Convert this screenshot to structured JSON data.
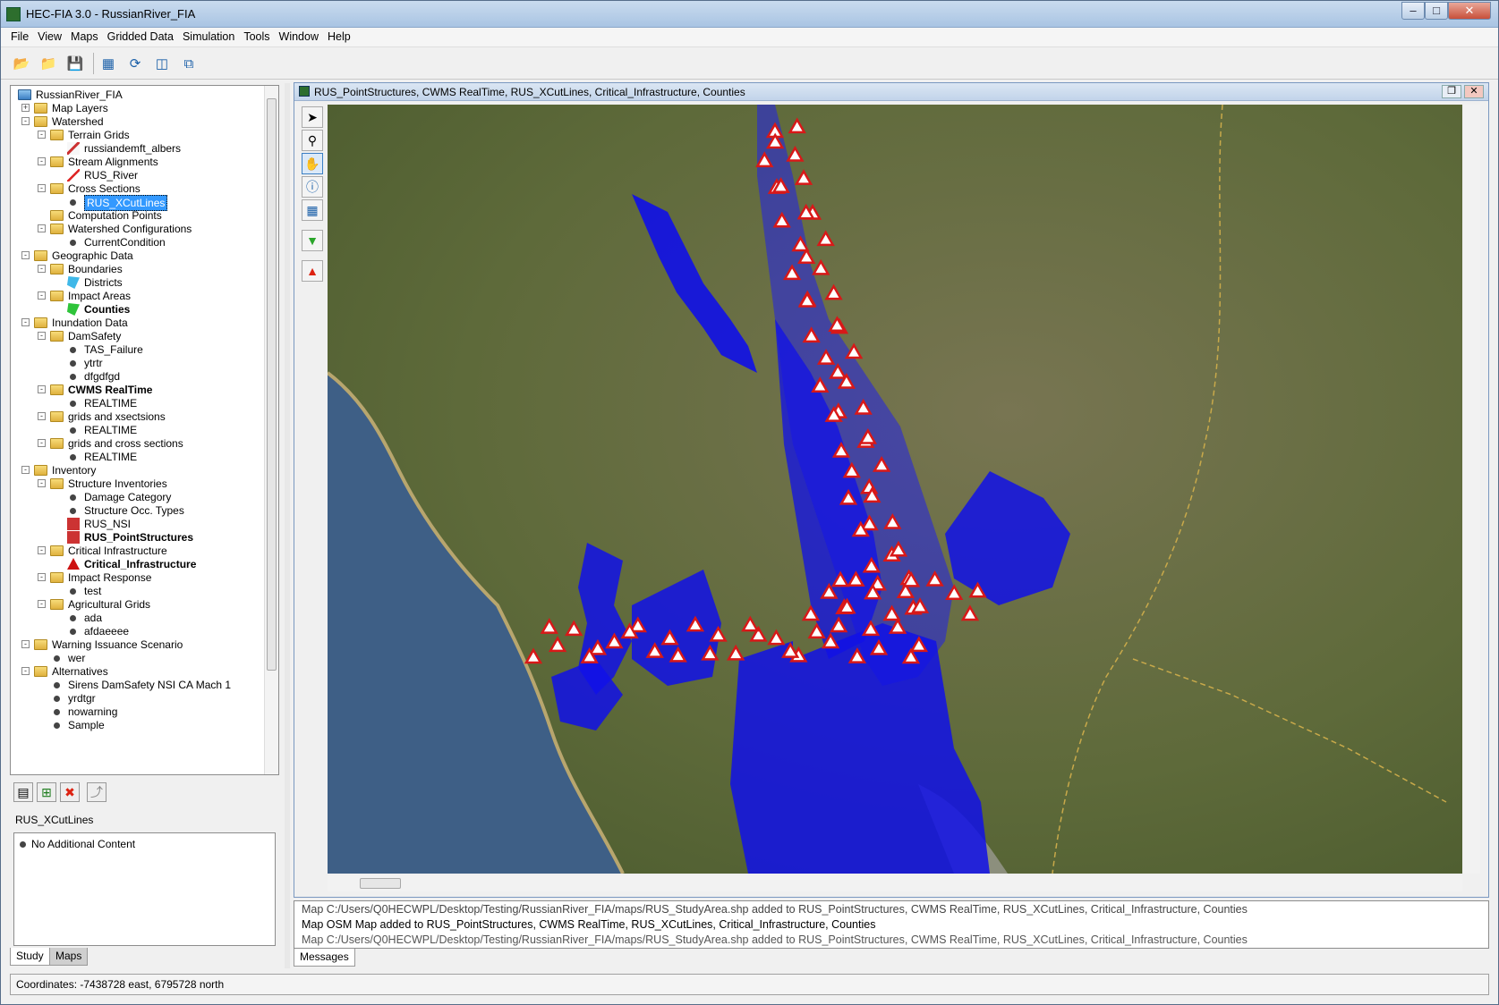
{
  "window": {
    "title": "HEC-FIA 3.0 - RussianRiver_FIA"
  },
  "menu": [
    "File",
    "View",
    "Maps",
    "Gridded Data",
    "Simulation",
    "Tools",
    "Window",
    "Help"
  ],
  "tree": {
    "root": "RussianRiver_FIA",
    "items": [
      {
        "label": "Map Layers",
        "level": 1,
        "type": "folder",
        "exp": "+"
      },
      {
        "label": "Watershed",
        "level": 1,
        "type": "folder",
        "exp": "-"
      },
      {
        "label": "Terrain Grids",
        "level": 2,
        "type": "folder",
        "exp": "-"
      },
      {
        "label": "russiandemft_albers",
        "level": 3,
        "type": "terrain"
      },
      {
        "label": "Stream Alignments",
        "level": 2,
        "type": "folder",
        "exp": "-"
      },
      {
        "label": "RUS_River",
        "level": 3,
        "type": "stream"
      },
      {
        "label": "Cross Sections",
        "level": 2,
        "type": "folder",
        "exp": "-"
      },
      {
        "label": "RUS_XCutLines",
        "level": 3,
        "type": "dot",
        "selected": true
      },
      {
        "label": "Computation Points",
        "level": 2,
        "type": "folder"
      },
      {
        "label": "Watershed Configurations",
        "level": 2,
        "type": "folder",
        "exp": "-"
      },
      {
        "label": "CurrentCondition",
        "level": 3,
        "type": "dot"
      },
      {
        "label": "Geographic Data",
        "level": 1,
        "type": "folder",
        "exp": "-"
      },
      {
        "label": "Boundaries",
        "level": 2,
        "type": "folder",
        "exp": "-"
      },
      {
        "label": "Districts",
        "level": 3,
        "type": "district"
      },
      {
        "label": "Impact Areas",
        "level": 2,
        "type": "folder",
        "exp": "-"
      },
      {
        "label": "Counties",
        "level": 3,
        "type": "county",
        "bold": true
      },
      {
        "label": "Inundation Data",
        "level": 1,
        "type": "folder",
        "exp": "-"
      },
      {
        "label": "DamSafety",
        "level": 2,
        "type": "folder",
        "exp": "-"
      },
      {
        "label": "TAS_Failure",
        "level": 3,
        "type": "dot"
      },
      {
        "label": "ytrtr",
        "level": 3,
        "type": "dot"
      },
      {
        "label": "dfgdfgd",
        "level": 3,
        "type": "dot"
      },
      {
        "label": "CWMS RealTime",
        "level": 2,
        "type": "folder",
        "exp": "-",
        "bold": true
      },
      {
        "label": "REALTIME",
        "level": 3,
        "type": "dot"
      },
      {
        "label": "grids and xsectsions",
        "level": 2,
        "type": "folder",
        "exp": "-"
      },
      {
        "label": "REALTIME",
        "level": 3,
        "type": "dot"
      },
      {
        "label": "grids and cross sections",
        "level": 2,
        "type": "folder",
        "exp": "-"
      },
      {
        "label": "REALTIME",
        "level": 3,
        "type": "dot"
      },
      {
        "label": "Inventory",
        "level": 1,
        "type": "folder",
        "exp": "-"
      },
      {
        "label": "Structure Inventories",
        "level": 2,
        "type": "folder",
        "exp": "-"
      },
      {
        "label": "Damage Category",
        "level": 3,
        "type": "dot"
      },
      {
        "label": "Structure Occ. Types",
        "level": 3,
        "type": "dot"
      },
      {
        "label": "RUS_NSI",
        "level": 3,
        "type": "structure"
      },
      {
        "label": "RUS_PointStructures",
        "level": 3,
        "type": "structure",
        "bold": true
      },
      {
        "label": "Critical Infrastructure",
        "level": 2,
        "type": "folder",
        "exp": "-"
      },
      {
        "label": "Critical_Infrastructure",
        "level": 3,
        "type": "warning",
        "bold": true
      },
      {
        "label": "Impact Response",
        "level": 2,
        "type": "folder",
        "exp": "-"
      },
      {
        "label": "test",
        "level": 3,
        "type": "dot"
      },
      {
        "label": "Agricultural Grids",
        "level": 2,
        "type": "folder",
        "exp": "-"
      },
      {
        "label": "ada",
        "level": 3,
        "type": "dot"
      },
      {
        "label": "afdaeeee",
        "level": 3,
        "type": "dot"
      },
      {
        "label": "Warning Issuance Scenario",
        "level": 1,
        "type": "folder",
        "exp": "-"
      },
      {
        "label": "wer",
        "level": 2,
        "type": "dot"
      },
      {
        "label": "Alternatives",
        "level": 1,
        "type": "folder",
        "exp": "-"
      },
      {
        "label": "Sirens DamSafety NSI CA Mach 1",
        "level": 2,
        "type": "dot"
      },
      {
        "label": "yrdtgr",
        "level": 2,
        "type": "dot"
      },
      {
        "label": "nowarning",
        "level": 2,
        "type": "dot"
      },
      {
        "label": "Sample",
        "level": 2,
        "type": "dot"
      }
    ]
  },
  "selected_item": "RUS_XCutLines",
  "content_panel": {
    "line": "No Additional Content"
  },
  "left_tabs": {
    "study": "Study",
    "maps": "Maps"
  },
  "map_window": {
    "title": "RUS_PointStructures, CWMS RealTime, RUS_XCutLines, Critical_Infrastructure, Counties"
  },
  "messages": [
    "Map C:/Users/Q0HECWPL/Desktop/Testing/RussianRiver_FIA/maps/RUS_StudyArea.shp added to RUS_PointStructures, CWMS RealTime, RUS_XCutLines, Critical_Infrastructure, Counties",
    "Map OSM Map added to RUS_PointStructures, CWMS RealTime, RUS_XCutLines, Critical_Infrastructure, Counties",
    "Map C:/Users/Q0HECWPL/Desktop/Testing/RussianRiver_FIA/maps/RUS_StudyArea.shp added to RUS_PointStructures, CWMS RealTime, RUS_XCutLines, Critical_Infrastructure, Counties"
  ],
  "messages_tab": "Messages",
  "status": {
    "coordinates": "Coordinates: -7438728 east, 6795728 north"
  },
  "colors": {
    "flood": "#1010e8",
    "warning": "#d81818",
    "accent": "#3399ff",
    "terrain": "#6d6b43",
    "ocean": "#3e5f86"
  }
}
